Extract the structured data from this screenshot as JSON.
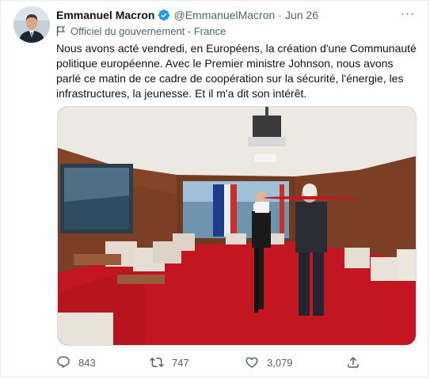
{
  "tweet": {
    "author_name": "Emmanuel Macron",
    "handle": "@EmmanuelMacron",
    "separator": "·",
    "date": "Jun 26",
    "more_label": "···",
    "label": "Officiel du gouvernement - France",
    "text": "Nous avons acté vendredi, en Européens, la création d'une Communauté politique européenne. Avec le Premier ministre Johnson, nous avons parlé ce matin de ce cadre de coopération sur la sécurité, l'énergie, les infrastructures, la jeunesse. Et il m'a dit son intérêt.",
    "colors": {
      "verified": "#1d9bf0",
      "muted": "#536471",
      "text": "#0f1419"
    }
  },
  "actions": {
    "reply_count": "843",
    "retweet_count": "747",
    "like_count": "3,079"
  },
  "icons": [
    "verified-badge-icon",
    "more-icon",
    "flag-icon",
    "reply-icon",
    "retweet-icon",
    "like-icon",
    "share-icon"
  ]
}
